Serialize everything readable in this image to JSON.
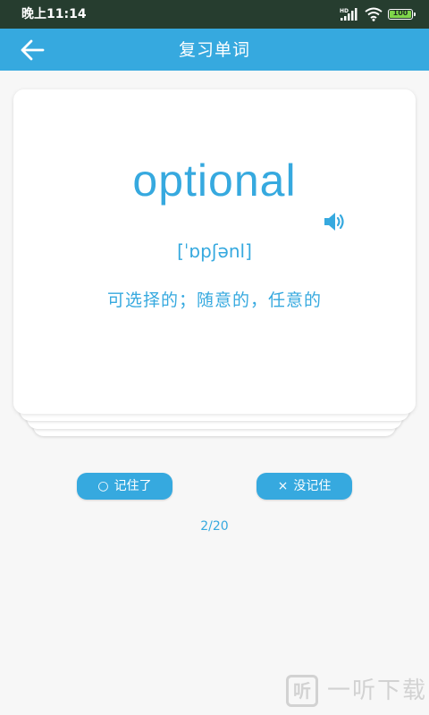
{
  "status_bar": {
    "time": "晚上11:14",
    "battery_level": "100",
    "icons": [
      "hd-signal-icon",
      "wifi-icon",
      "battery-icon"
    ]
  },
  "app_bar": {
    "title": "复习单词",
    "back_icon": "arrow-left-icon"
  },
  "card": {
    "word": "optional",
    "phonetic": "[ˈɒpʃənl]",
    "meaning": "可选择的；随意的，任意的",
    "speaker_icon": "speaker-icon"
  },
  "actions": {
    "remembered": {
      "symbol": "○",
      "label": "记住了"
    },
    "forgot": {
      "symbol": "×",
      "label": "没记住"
    }
  },
  "progress": {
    "text": "2/20",
    "current": 2,
    "total": 20
  },
  "watermark": {
    "logo_char": "听",
    "text": "一听下载"
  },
  "colors": {
    "accent": "#36a9df",
    "status_bar_bg": "#263d2f",
    "page_bg": "#f7f7f7",
    "card_bg": "#ffffff",
    "battery_fill": "#7fd64a"
  }
}
